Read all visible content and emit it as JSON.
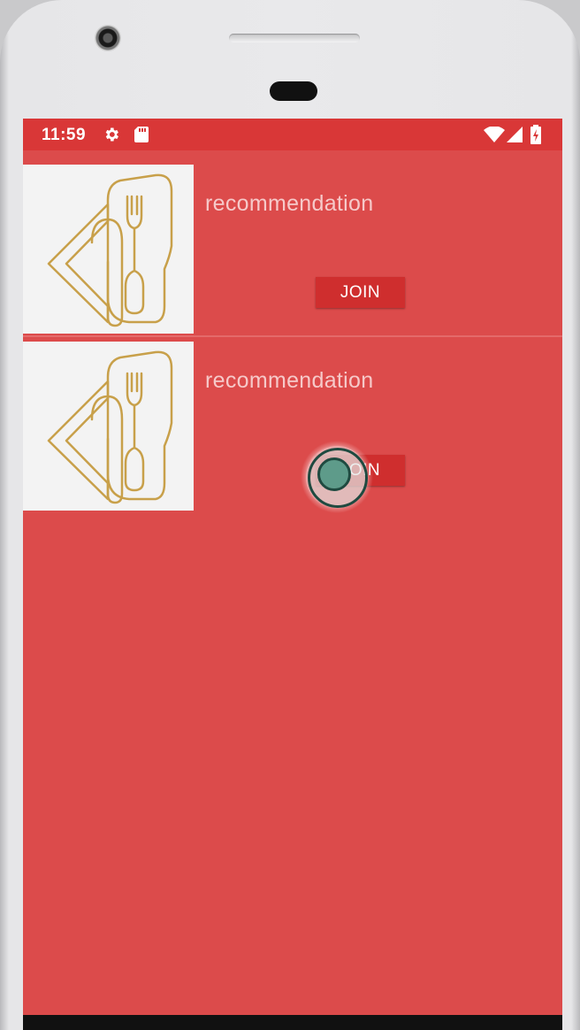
{
  "status_bar": {
    "time": "11:59",
    "icons": [
      "settings-icon",
      "sd-card-icon",
      "wifi-icon",
      "cell-signal-icon",
      "battery-charging-icon"
    ]
  },
  "list": {
    "items": [
      {
        "title": "recommendation",
        "button_label": "JOIN",
        "thumbnail": "restaurant-logo-icon"
      },
      {
        "title": "recommendation",
        "button_label": "JOIN",
        "thumbnail": "restaurant-logo-icon"
      }
    ]
  },
  "colors": {
    "status_bar": "#d93737",
    "background": "#dc4b4b",
    "button": "#cf2e2e",
    "title_text": "#f6c9c9",
    "logo_stroke": "#c8a04a"
  }
}
